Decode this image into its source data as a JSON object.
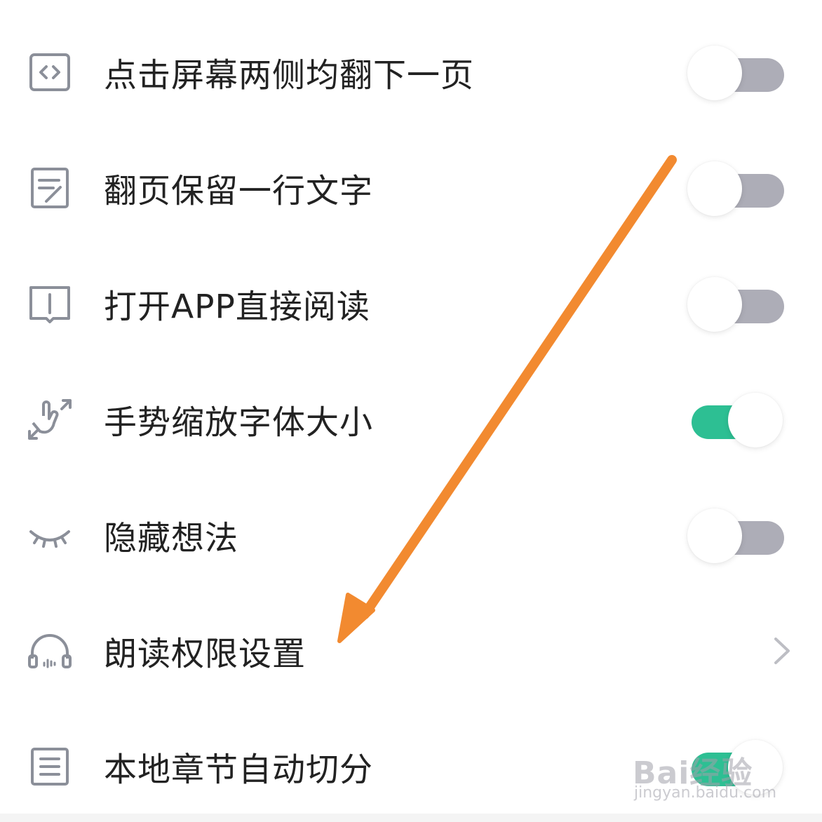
{
  "settings": {
    "items": [
      {
        "label": "点击屏幕两侧均翻下一页",
        "icon": "code-brackets-icon",
        "control": "toggle",
        "on": false
      },
      {
        "label": "翻页保留一行文字",
        "icon": "edit-note-icon",
        "control": "toggle",
        "on": false
      },
      {
        "label": "打开APP直接阅读",
        "icon": "open-book-icon",
        "control": "toggle",
        "on": false
      },
      {
        "label": "手势缩放字体大小",
        "icon": "gesture-zoom-icon",
        "control": "toggle",
        "on": true
      },
      {
        "label": "隐藏想法",
        "icon": "closed-eye-icon",
        "control": "toggle",
        "on": false
      },
      {
        "label": "朗读权限设置",
        "icon": "headphones-icon",
        "control": "chevron"
      },
      {
        "label": "本地章节自动切分",
        "icon": "list-document-icon",
        "control": "toggle",
        "on": true
      }
    ]
  },
  "colors": {
    "toggle_on": "#2dbf93",
    "toggle_off": "#adadb7",
    "annotation_arrow": "#f28a30"
  },
  "watermark": {
    "logo": "Bai经验",
    "url": "jingyan.baidu.com"
  }
}
